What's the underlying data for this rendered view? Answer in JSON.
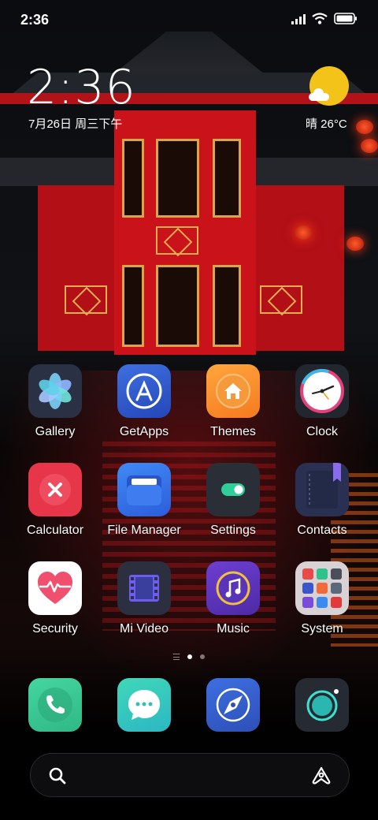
{
  "status_bar": {
    "time": "2:36",
    "icons": [
      "signal-icon",
      "wifi-icon",
      "battery-icon"
    ]
  },
  "clock_widget": {
    "time": "2:36",
    "date": "7月26日 周三下午",
    "weather": "晴 26°C",
    "weather_icon": "sunny-cloud-icon"
  },
  "apps": {
    "gallery": {
      "label": "Gallery",
      "icon": "gallery-icon"
    },
    "getapps": {
      "label": "GetApps",
      "icon": "getapps-icon"
    },
    "themes": {
      "label": "Themes",
      "icon": "themes-icon"
    },
    "clock": {
      "label": "Clock",
      "icon": "clock-icon"
    },
    "calculator": {
      "label": "Calculator",
      "icon": "calculator-icon"
    },
    "file_manager": {
      "label": "File Manager",
      "icon": "file-manager-icon"
    },
    "settings": {
      "label": "Settings",
      "icon": "settings-icon"
    },
    "contacts": {
      "label": "Contacts",
      "icon": "contacts-icon"
    },
    "security": {
      "label": "Security",
      "icon": "security-icon"
    },
    "mi_video": {
      "label": "Mi Video",
      "icon": "mi-video-icon"
    },
    "music": {
      "label": "Music",
      "icon": "music-icon"
    },
    "system": {
      "label": "System",
      "icon": "system-folder-icon"
    }
  },
  "page_indicator": {
    "pages": 2,
    "current": 1
  },
  "dock": [
    "phone-icon",
    "messaging-icon",
    "browser-icon",
    "camera-icon"
  ],
  "search_bar": {
    "icons": [
      "search-icon",
      "assistant-icon"
    ]
  },
  "colors": {
    "calculator": "#e7364a",
    "themes": "#f57a1f",
    "music": "#6d3fd1",
    "phone": "#45d6a0",
    "sun": "#f4c31a"
  }
}
